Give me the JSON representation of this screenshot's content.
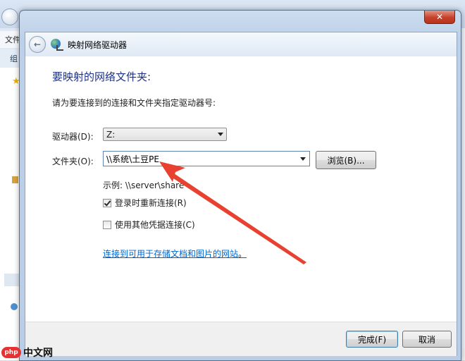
{
  "background": {
    "menu_text": "文件",
    "toolbar_text": "组"
  },
  "dialog": {
    "title": "映射网络驱动器",
    "heading": "要映射的网络文件夹:",
    "instruction": "请为要连接到的连接和文件夹指定驱动器号:",
    "drive_label": "驱动器(D):",
    "drive_value": "Z:",
    "folder_label": "文件夹(O):",
    "folder_value": "\\\\系统\\土豆PE",
    "browse_label": "浏览(B)...",
    "example": "示例: \\\\server\\share",
    "reconnect_label": "登录时重新连接(R)",
    "reconnect_checked": true,
    "other_cred_label": "使用其他凭据连接(C)",
    "other_cred_checked": false,
    "link_text": "连接到可用于存储文档和图片的网站",
    "link_suffix": "。",
    "finish_label": "完成(F)",
    "cancel_label": "取消",
    "close_glyph": "✕"
  },
  "watermark": {
    "logo": "php",
    "text": "中文网"
  },
  "colors": {
    "heading": "#1e3287",
    "link": "#0066cc",
    "annotation_arrow": "#e8412f"
  }
}
